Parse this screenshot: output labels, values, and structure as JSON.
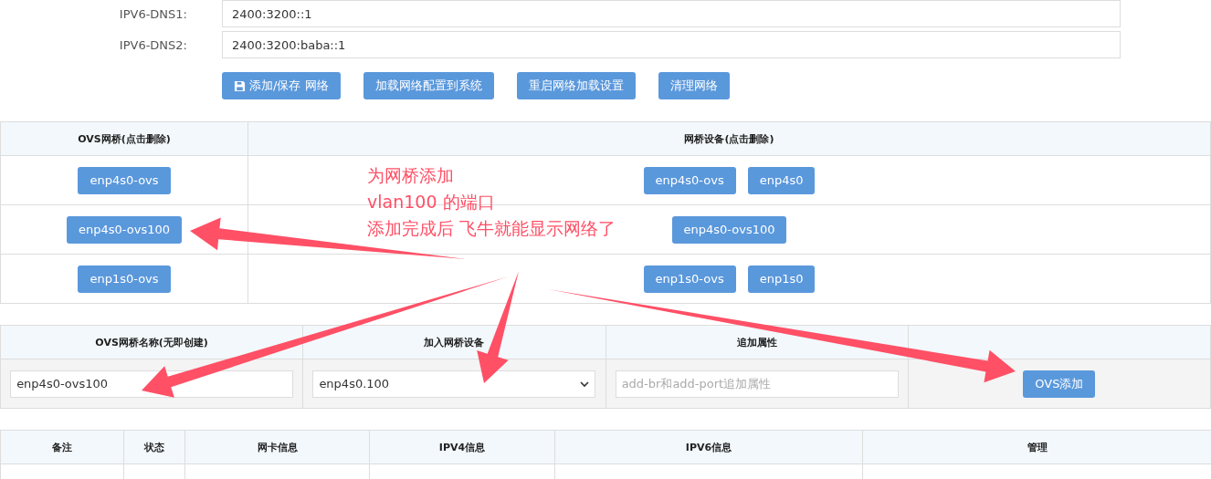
{
  "dns_fields": [
    {
      "label": "IPV6-DNS1:",
      "value": "2400:3200::1"
    },
    {
      "label": "IPV6-DNS2:",
      "value": "2400:3200:baba::1"
    }
  ],
  "actions": [
    {
      "label": "添加/保存 网络",
      "kind": "save"
    },
    {
      "label": "加载网络配置到系统",
      "kind": "plain"
    },
    {
      "label": "重启网络加载设置",
      "kind": "plain"
    },
    {
      "label": "清理网络",
      "kind": "plain"
    }
  ],
  "bridge_table": {
    "columns": [
      "OVS网桥(点击删除)",
      "网桥设备(点击删除)"
    ],
    "rows": [
      {
        "bridge": "enp4s0-ovs",
        "devices": [
          "enp4s0-ovs",
          "enp4s0"
        ]
      },
      {
        "bridge": "enp4s0-ovs100",
        "devices": [
          "enp4s0-ovs100"
        ]
      },
      {
        "bridge": "enp1s0-ovs",
        "devices": [
          "enp1s0-ovs",
          "enp1s0"
        ]
      }
    ]
  },
  "add_form": {
    "columns": [
      "OVS网桥名称(无即创建)",
      "加入网桥设备",
      "追加属性"
    ],
    "bridge_name": {
      "value": "enp4s0-ovs100"
    },
    "device": {
      "value": "enp4s0.100"
    },
    "extra": {
      "placeholder": "add-br和add-port追加属性"
    },
    "button": "OVS添加"
  },
  "nic_table": {
    "columns": [
      "备注",
      "状态",
      "网卡信息",
      "IPV4信息",
      "IPV6信息",
      "管理"
    ]
  },
  "annotation": {
    "lines": [
      "为网桥添加",
      "vlan100 的端口",
      "添加完成后 飞牛就能显示网络了"
    ]
  }
}
